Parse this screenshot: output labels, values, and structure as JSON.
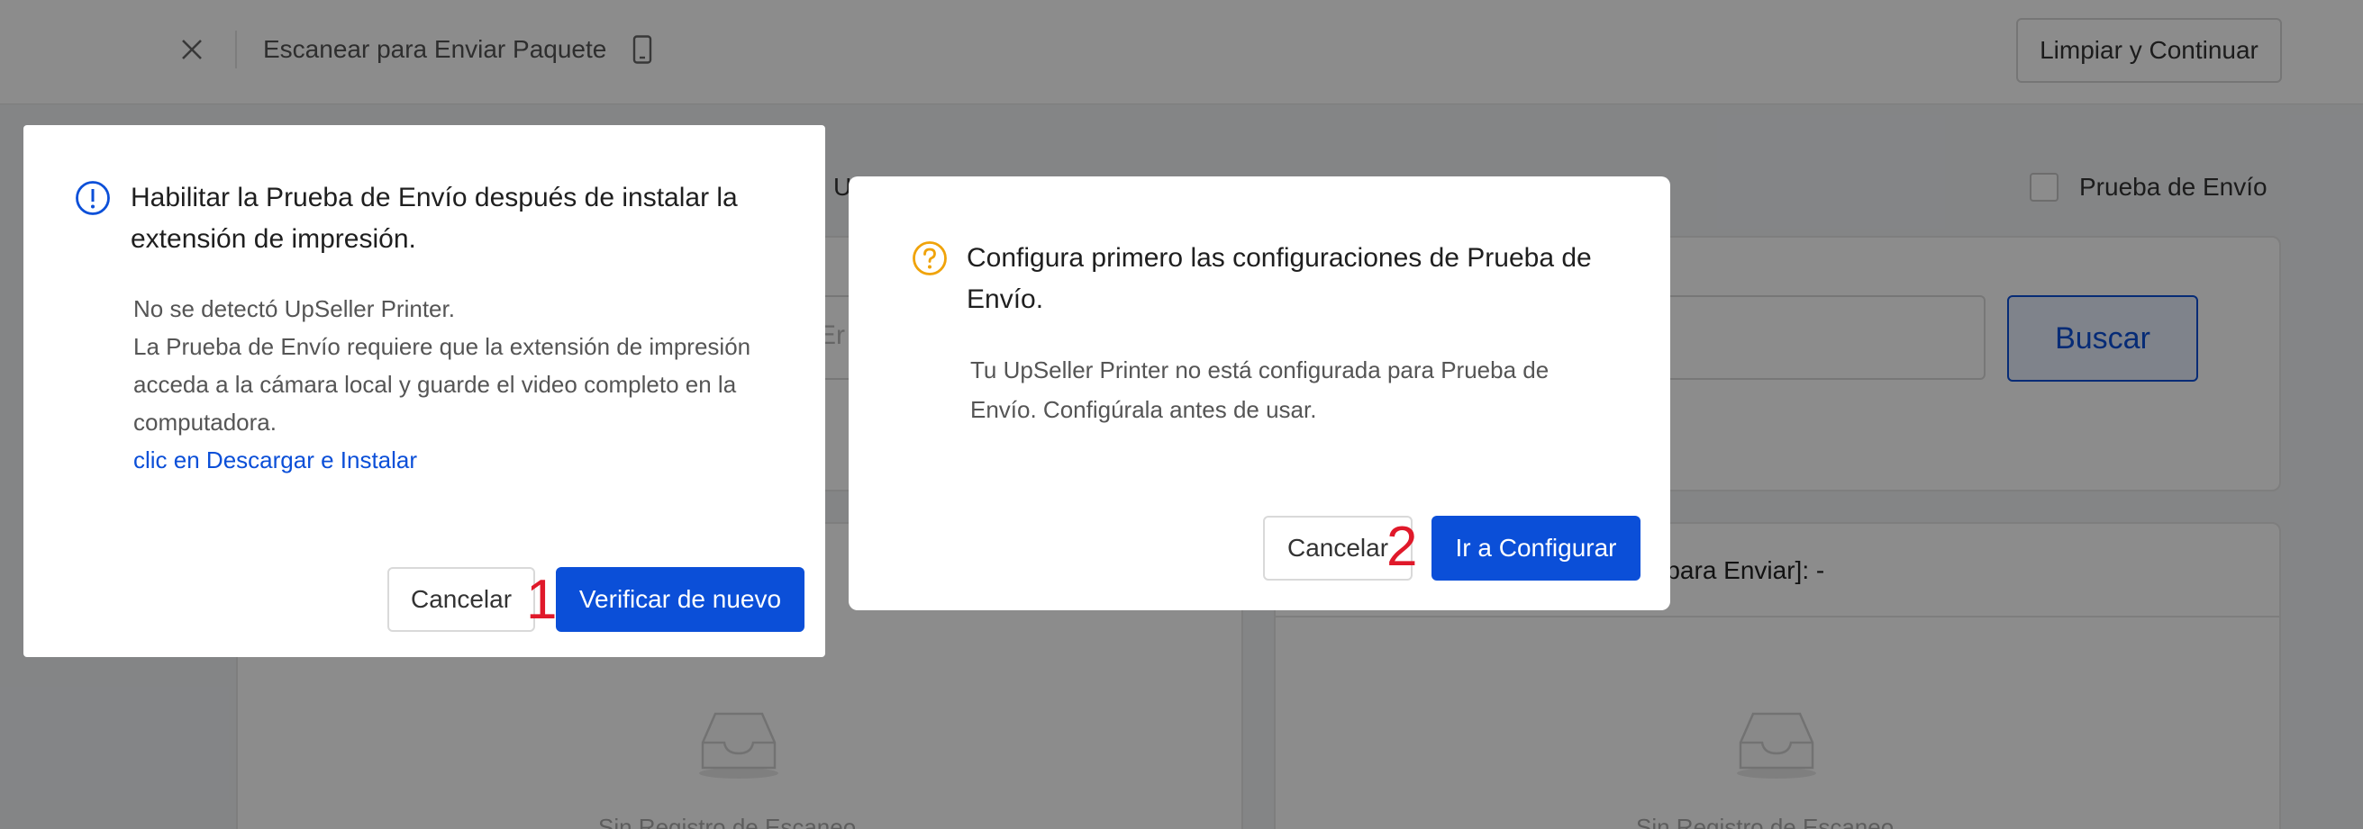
{
  "topbar": {
    "close_icon": "close-icon",
    "title": "Escanear para Enviar Paquete",
    "phone_icon": "mobile-phone-icon",
    "clear_button": "Limpiar y Continuar"
  },
  "background": {
    "partial_label": "U",
    "checkbox_label": "Prueba de Envío",
    "search_placeholder_partial": "Er",
    "search_button": "Buscar",
    "right_card_title_partial": "o para Enviar]: -",
    "empty_text_partial": "Sin Registro de Escaneo",
    "empty_icon": "empty-inbox-icon"
  },
  "modal1": {
    "icon": "info-circle-icon",
    "icon_color": "#0b4fd8",
    "title": "Habilitar la Prueba de Envío después de instalar la extensión de impresión.",
    "body_lines": [
      "No se detectó UpSeller Printer.",
      "La Prueba de Envío requiere que la extensión de impresión acceda a la cámara local y guarde el video completo en la computadora."
    ],
    "link": "clic en Descargar e Instalar",
    "cancel_button": "Cancelar",
    "confirm_button": "Verificar de nuevo",
    "step_marker": "1"
  },
  "modal2": {
    "icon": "question-circle-icon",
    "icon_color": "#f0a30a",
    "title": "Configura primero las configuraciones de Prueba de Envío.",
    "body": "Tu UpSeller Printer no está configurada para Prueba de Envío. Configúrala antes de usar.",
    "cancel_button": "Cancelar",
    "confirm_button": "Ir a Configurar",
    "step_marker": "2"
  },
  "colors": {
    "primary": "#0b4fd8",
    "marker": "#e0192a",
    "overlay": "rgba(0,0,0,0.45)"
  }
}
